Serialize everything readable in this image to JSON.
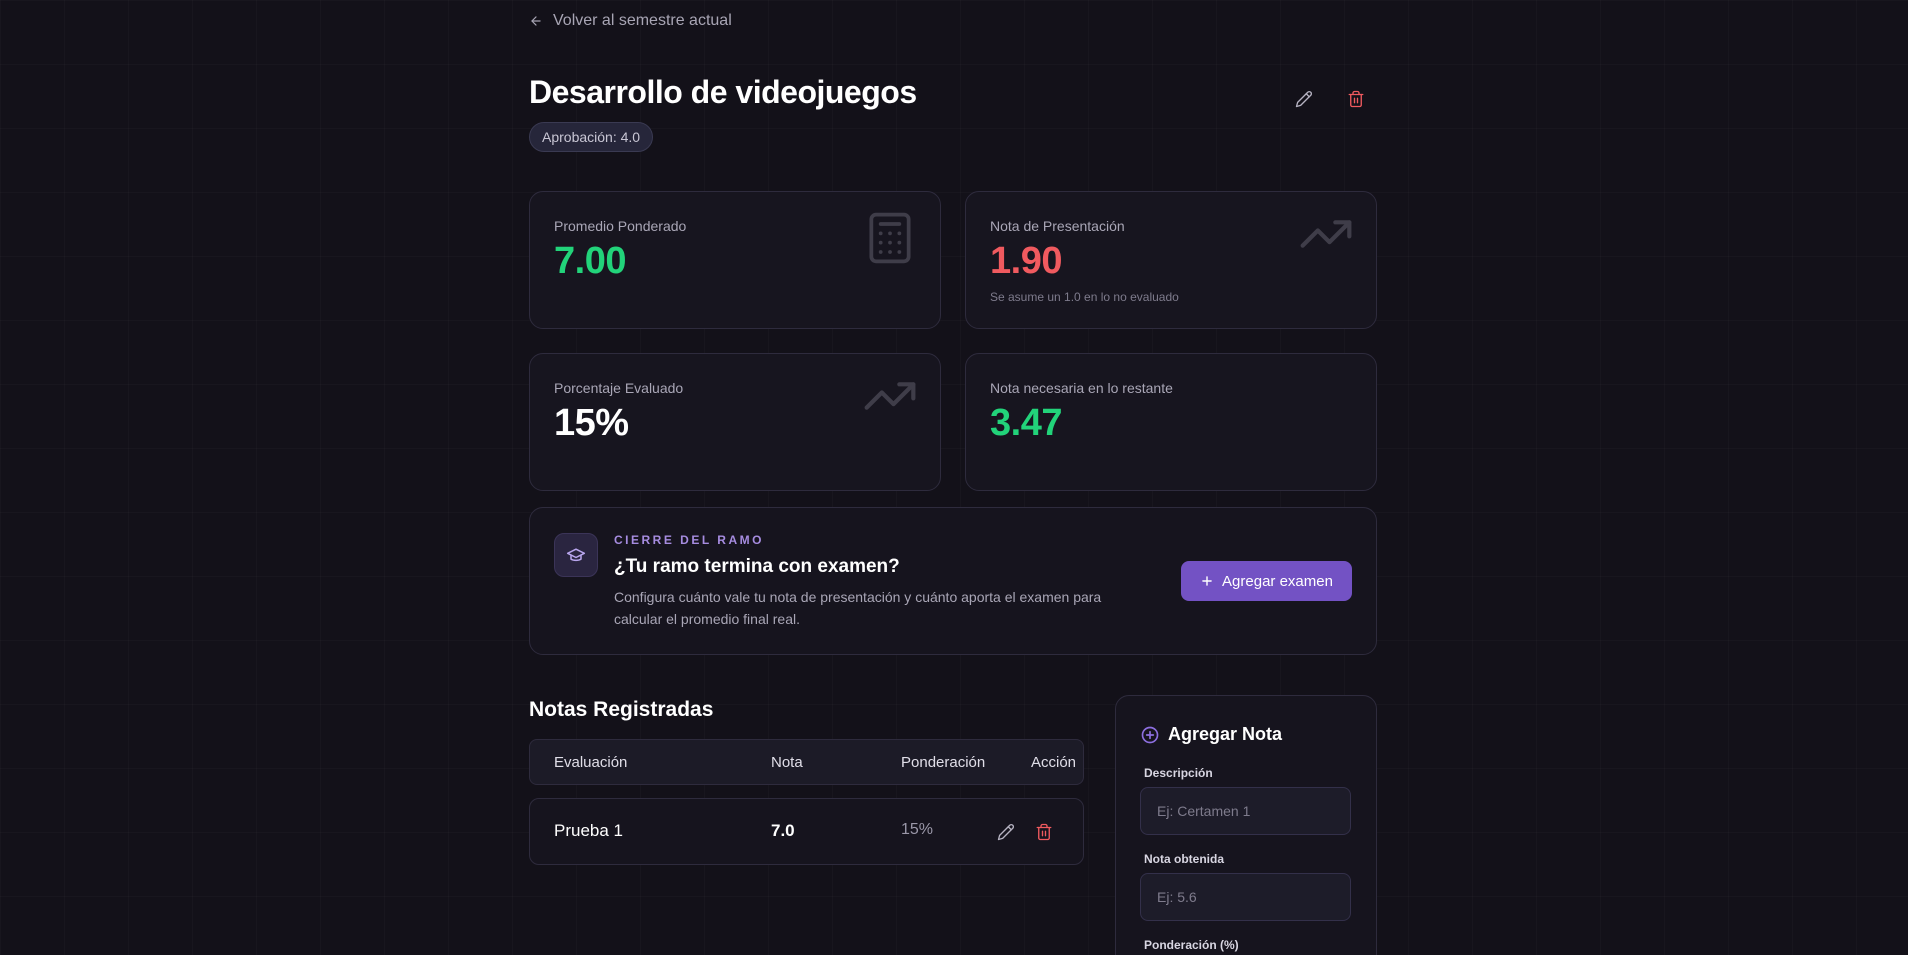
{
  "back_link": {
    "label": "Volver al semestre actual"
  },
  "course": {
    "title": "Desarrollo de videojuegos",
    "approval_badge": "Aprobación: 4.0"
  },
  "stats": {
    "weighted_avg": {
      "label": "Promedio Ponderado",
      "value": "7.00",
      "color": "#22d37a",
      "icon": "calculator-icon"
    },
    "presentation": {
      "label": "Nota de Presentación",
      "value": "1.90",
      "color": "#f05a5f",
      "note": "Se asume un 1.0 en lo no evaluado",
      "icon": "trending-up-icon"
    },
    "evaluated_pct": {
      "label": "Porcentaje Evaluado",
      "value": "15%",
      "color": "#ffffff",
      "icon": "trending-up-icon"
    },
    "needed": {
      "label": "Nota necesaria en lo restante",
      "value": "3.47",
      "color": "#22d37a"
    }
  },
  "cierre": {
    "eyebrow": "CIERRE DEL RAMO",
    "heading": "¿Tu ramo termina con examen?",
    "description": "Configura cuánto vale tu nota de presentación y cuánto aporta el examen para calcular el promedio final real.",
    "button_label": "Agregar examen",
    "accent": "#7352c4"
  },
  "grades": {
    "title": "Notas Registradas",
    "columns": [
      "Evaluación",
      "Nota",
      "Ponderación",
      "Acción"
    ],
    "rows": [
      {
        "evaluacion": "Prueba 1",
        "nota": "7.0",
        "ponderacion": "15%"
      }
    ]
  },
  "add_grade": {
    "title": "Agregar Nota",
    "description_label": "Descripción",
    "description_placeholder": "Ej: Certamen 1",
    "grade_label": "Nota obtenida",
    "grade_placeholder": "Ej: 5.6",
    "weight_label": "Ponderación (%)"
  }
}
